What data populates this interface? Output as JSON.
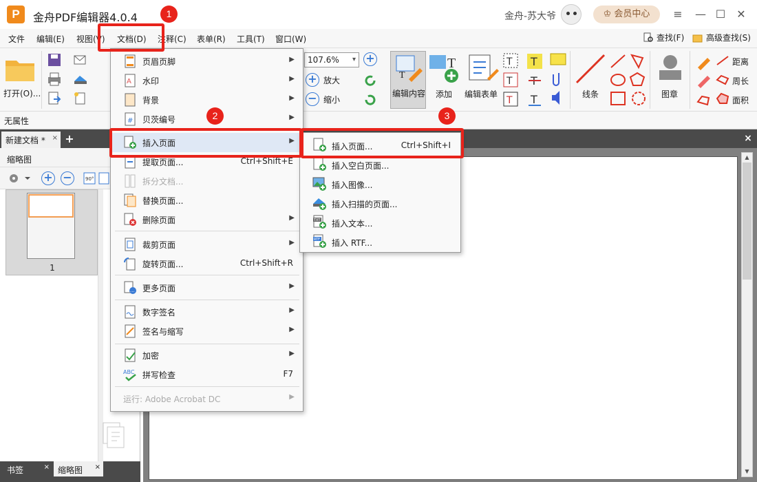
{
  "app": {
    "logo_letter": "P",
    "title": "金舟PDF编辑器4.0.4",
    "user": "金舟-苏大爷",
    "vip": "会员中心",
    "win_menu": "≡",
    "win_min": "—",
    "win_max": "☐",
    "win_close": "✕"
  },
  "menubar": {
    "items": [
      "文件",
      "编辑(E)",
      "视图(V)",
      "文档(D)",
      "注释(C)",
      "表单(R)",
      "工具(T)",
      "窗口(W)"
    ],
    "find": "查找(F)",
    "adv_find": "高级查找(S)"
  },
  "toolbar": {
    "open": "打开(O)...",
    "zoom_value": "107.6%",
    "zoom_in": "放大",
    "zoom_out": "缩小",
    "edit_content": "编辑内容",
    "add": "添加",
    "edit_form": "编辑表单",
    "line": "线条",
    "stamp": "图章",
    "distance": "距离",
    "perimeter": "周长",
    "area": "面积"
  },
  "propbar": {
    "text": "无属性"
  },
  "tabs": {
    "doc": "新建文档 *",
    "close": "×",
    "add": "+"
  },
  "left_panel": {
    "title": "缩略图",
    "page_num": "1",
    "bottom_tabs": [
      "书签",
      "缩略图"
    ]
  },
  "doc_menu": {
    "items": [
      {
        "label": "页眉页脚",
        "shortcut": "",
        "submenu": true
      },
      {
        "label": "水印",
        "shortcut": "",
        "submenu": true
      },
      {
        "label": "背景",
        "shortcut": "",
        "submenu": true
      },
      {
        "label": "贝茨编号",
        "shortcut": "",
        "submenu": true
      },
      {
        "label": "插入页面",
        "shortcut": "",
        "submenu": true
      },
      {
        "label": "提取页面...",
        "shortcut": "Ctrl+Shift+E",
        "submenu": false
      },
      {
        "label": "拆分文档...",
        "shortcut": "",
        "submenu": false,
        "disabled": true
      },
      {
        "label": "替换页面...",
        "shortcut": "",
        "submenu": false
      },
      {
        "label": "删除页面",
        "shortcut": "",
        "submenu": true
      },
      {
        "label": "裁剪页面",
        "shortcut": "",
        "submenu": true
      },
      {
        "label": "旋转页面...",
        "shortcut": "Ctrl+Shift+R",
        "submenu": false
      },
      {
        "label": "更多页面",
        "shortcut": "",
        "submenu": true
      },
      {
        "label": "数字签名",
        "shortcut": "",
        "submenu": true
      },
      {
        "label": "签名与缩写",
        "shortcut": "",
        "submenu": true
      },
      {
        "label": "加密",
        "shortcut": "",
        "submenu": true
      },
      {
        "label": "拼写检查",
        "shortcut": "F7",
        "submenu": false
      },
      {
        "label": "运行: Adobe Acrobat DC",
        "shortcut": "",
        "submenu": true,
        "disabled": true
      }
    ]
  },
  "insert_submenu": {
    "items": [
      {
        "label": "插入页面...",
        "shortcut": "Ctrl+Shift+I"
      },
      {
        "label": "插入空白页面...",
        "shortcut": ""
      },
      {
        "label": "插入图像...",
        "shortcut": ""
      },
      {
        "label": "插入扫描的页面...",
        "shortcut": ""
      },
      {
        "label": "插入文本...",
        "shortcut": ""
      },
      {
        "label": "插入 RTF...",
        "shortcut": ""
      }
    ]
  },
  "annotations": {
    "step1": "1",
    "step2": "2",
    "step3": "3",
    "color": "#e8231b"
  }
}
